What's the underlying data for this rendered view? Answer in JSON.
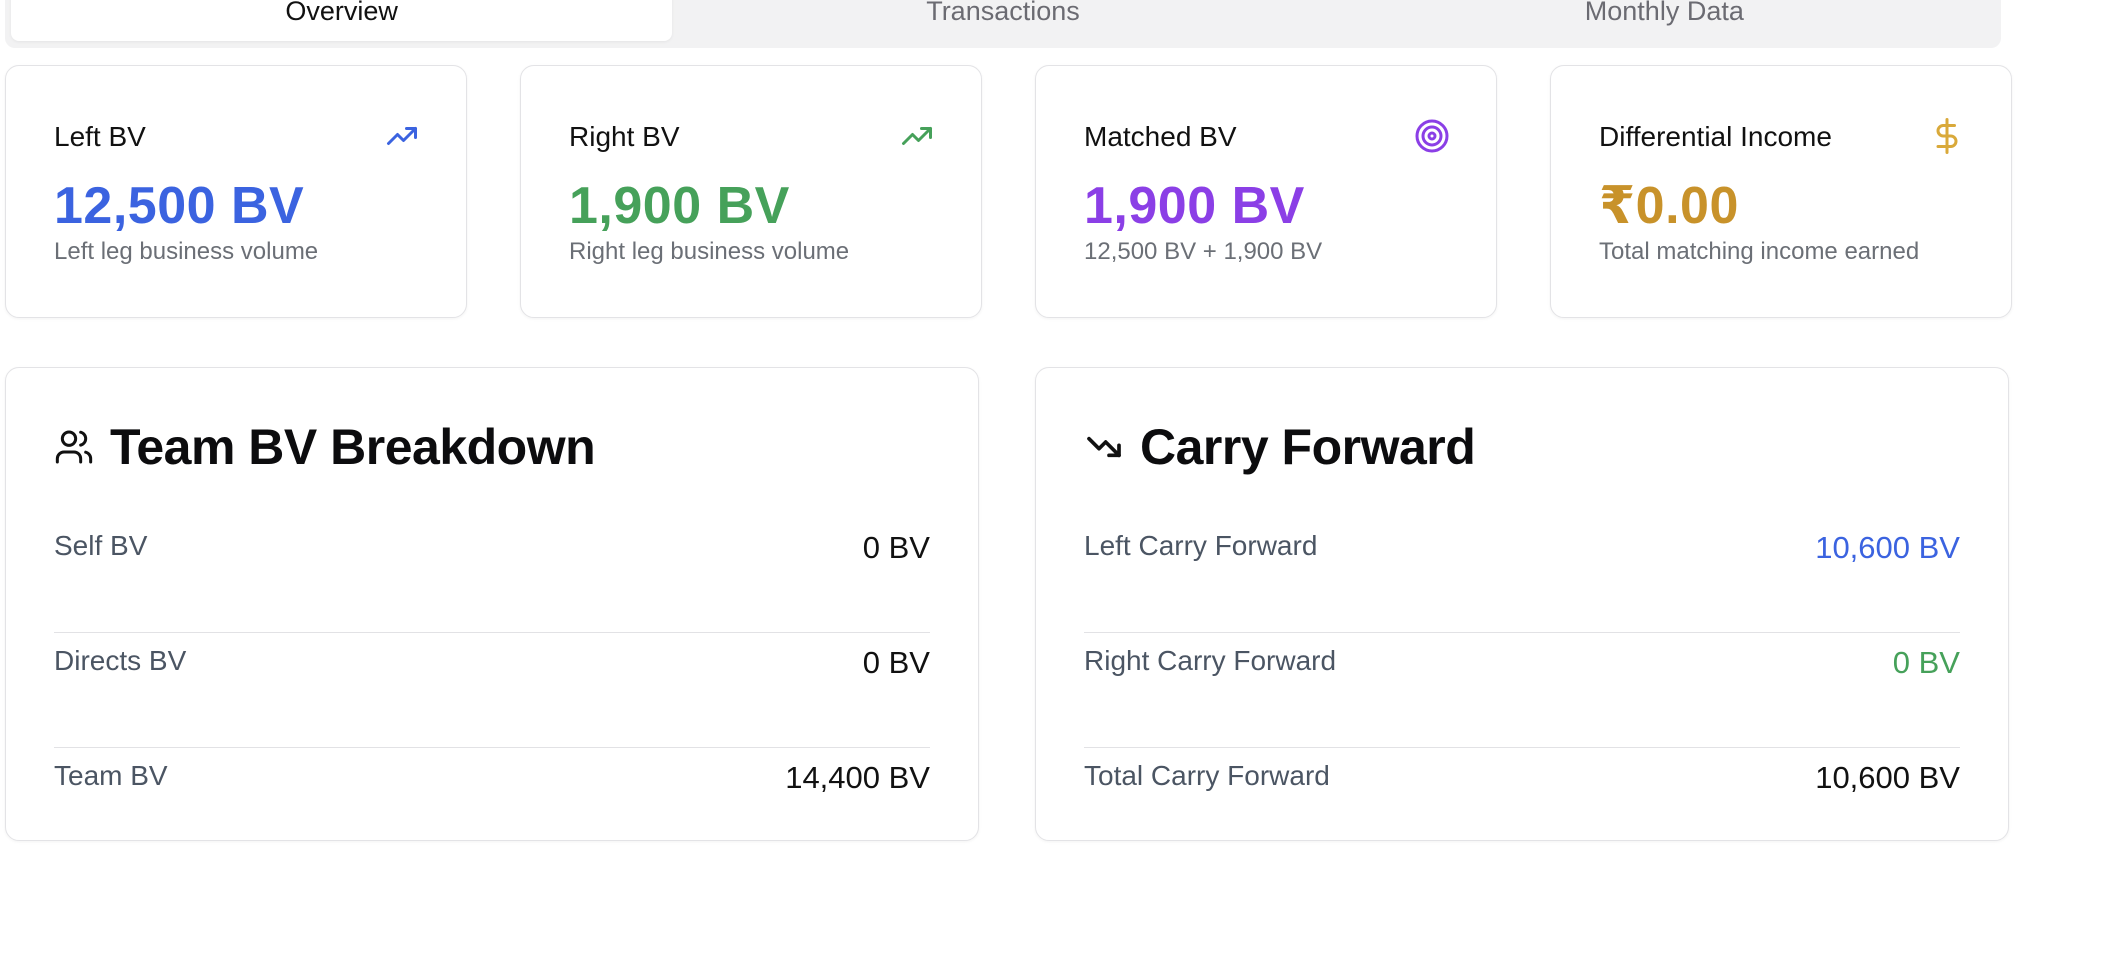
{
  "tabs": [
    {
      "label": "Overview"
    },
    {
      "label": "Transactions"
    },
    {
      "label": "Monthly Data"
    }
  ],
  "stats": [
    {
      "title": "Left BV",
      "value": "12,500 BV",
      "sub": "Left leg business volume",
      "icon": "trending-up-icon",
      "color": "#3b63e0"
    },
    {
      "title": "Right BV",
      "value": "1,900 BV",
      "sub": "Right leg business volume",
      "icon": "trending-up-icon",
      "color": "#46a15a"
    },
    {
      "title": "Matched BV",
      "value": "1,900 BV",
      "sub": "12,500 BV + 1,900 BV",
      "icon": "target-icon",
      "color": "#8b3fe6"
    },
    {
      "title": "Differential Income",
      "value": "₹0.00",
      "sub": "Total matching income earned",
      "icon": "dollar-icon",
      "color": "#c8922a"
    }
  ],
  "team": {
    "title": "Team BV Breakdown",
    "icon": "users-icon",
    "rows": [
      {
        "label": "Self BV",
        "value": "0 BV"
      },
      {
        "label": "Directs BV",
        "value": "0 BV"
      },
      {
        "label": "Team BV",
        "value": "14,400 BV"
      }
    ]
  },
  "carry": {
    "title": "Carry Forward",
    "icon": "trending-down-icon",
    "rows": [
      {
        "label": "Left Carry Forward",
        "value": "10,600 BV",
        "color": "#3b63e0"
      },
      {
        "label": "Right Carry Forward",
        "value": "0 BV",
        "color": "#46a15a"
      },
      {
        "label": "Total Carry Forward",
        "value": "10,600 BV",
        "color": "#111111"
      }
    ]
  }
}
